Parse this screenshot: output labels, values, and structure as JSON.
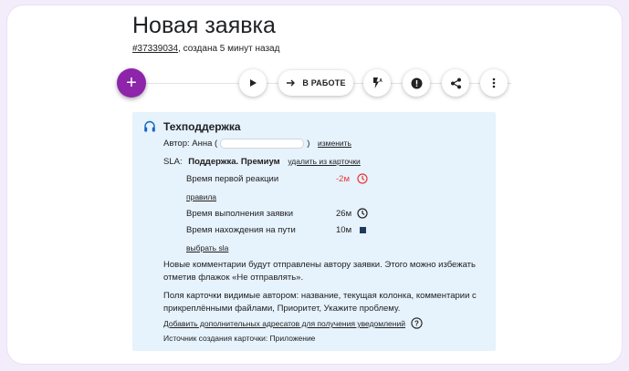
{
  "page": {
    "title": "Новая заявка",
    "ticket_id": "#37339034",
    "created": ", создана 5 минут назад"
  },
  "toolbar": {
    "add_label": "+",
    "status_label": "В РАБОТЕ"
  },
  "card": {
    "header": "Техподдержка",
    "author_label": "Автор: Анна (",
    "author_close": ")",
    "change_link": "изменить",
    "sla_label": "SLA:",
    "sla_value": "Поддержка. Премиум",
    "remove_link": "удалить из карточки",
    "metrics": [
      {
        "label": "Время первой реакции",
        "value": "-2м"
      },
      {
        "label": "Время выполнения заявки",
        "value": "26м"
      },
      {
        "label": "Время нахождения на пути",
        "value": "10м"
      }
    ],
    "rules_link": "правила",
    "choose_sla_link": "выбрать sla",
    "note1_line1": "Новые комментарии будут отправлены автору заявки. Этого можно избежать",
    "note1_line2": "отметив флажок «Не отправлять».",
    "note2_line1": "Поля карточки видимые автором: название, текущая колонка, комментарии с",
    "note2_line2": "прикреплёнными файлами, Приоритет, Укажите проблему.",
    "add_recipients_link": "Добавить дополнительных адресатов для получения уведомлений",
    "source": "Источник создания карточки: Приложение"
  },
  "colors": {
    "accent": "#8e24aa",
    "card_bg": "#e6f2fc",
    "danger": "#e53935",
    "info_icon": "#1565c0"
  }
}
